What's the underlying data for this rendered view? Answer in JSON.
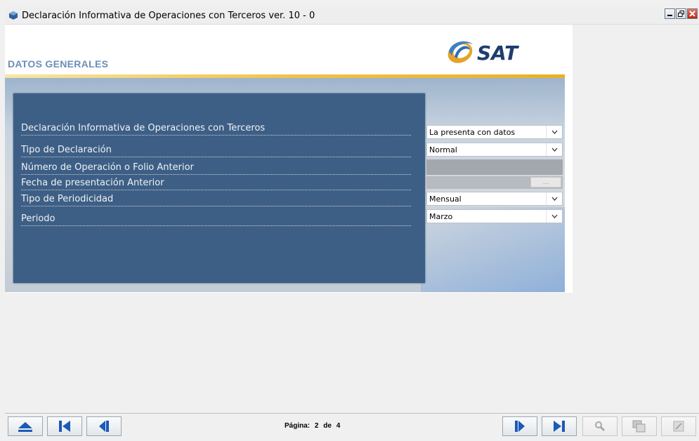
{
  "window": {
    "title": "Declaración Informativa de Operaciones con Terceros ver. 10 - 0"
  },
  "header": {
    "title": "DATOS GENERALES",
    "logo_text": "SAT"
  },
  "form": {
    "rows": [
      {
        "label": "Declaración Informativa de Operaciones con Terceros",
        "value": "La presenta con datos"
      },
      {
        "label": "Tipo de Declaración",
        "value": "Normal"
      },
      {
        "label": "Número de Operación o Folio Anterior",
        "value": ""
      },
      {
        "label": "Fecha de presentación Anterior",
        "value": "",
        "button": "..."
      },
      {
        "label": "Tipo de Periodicidad",
        "value": "Mensual"
      },
      {
        "label": "Periodo",
        "value": "Marzo"
      }
    ]
  },
  "footer": {
    "page_label": "Página:",
    "current_page": "2",
    "of_label": "de",
    "total_pages": "4"
  },
  "colors": {
    "panel": "#3e5f85",
    "header_title": "#6b8fb8",
    "gold_line": "#f2c34a",
    "nav_arrow": "#1a5ab8"
  }
}
